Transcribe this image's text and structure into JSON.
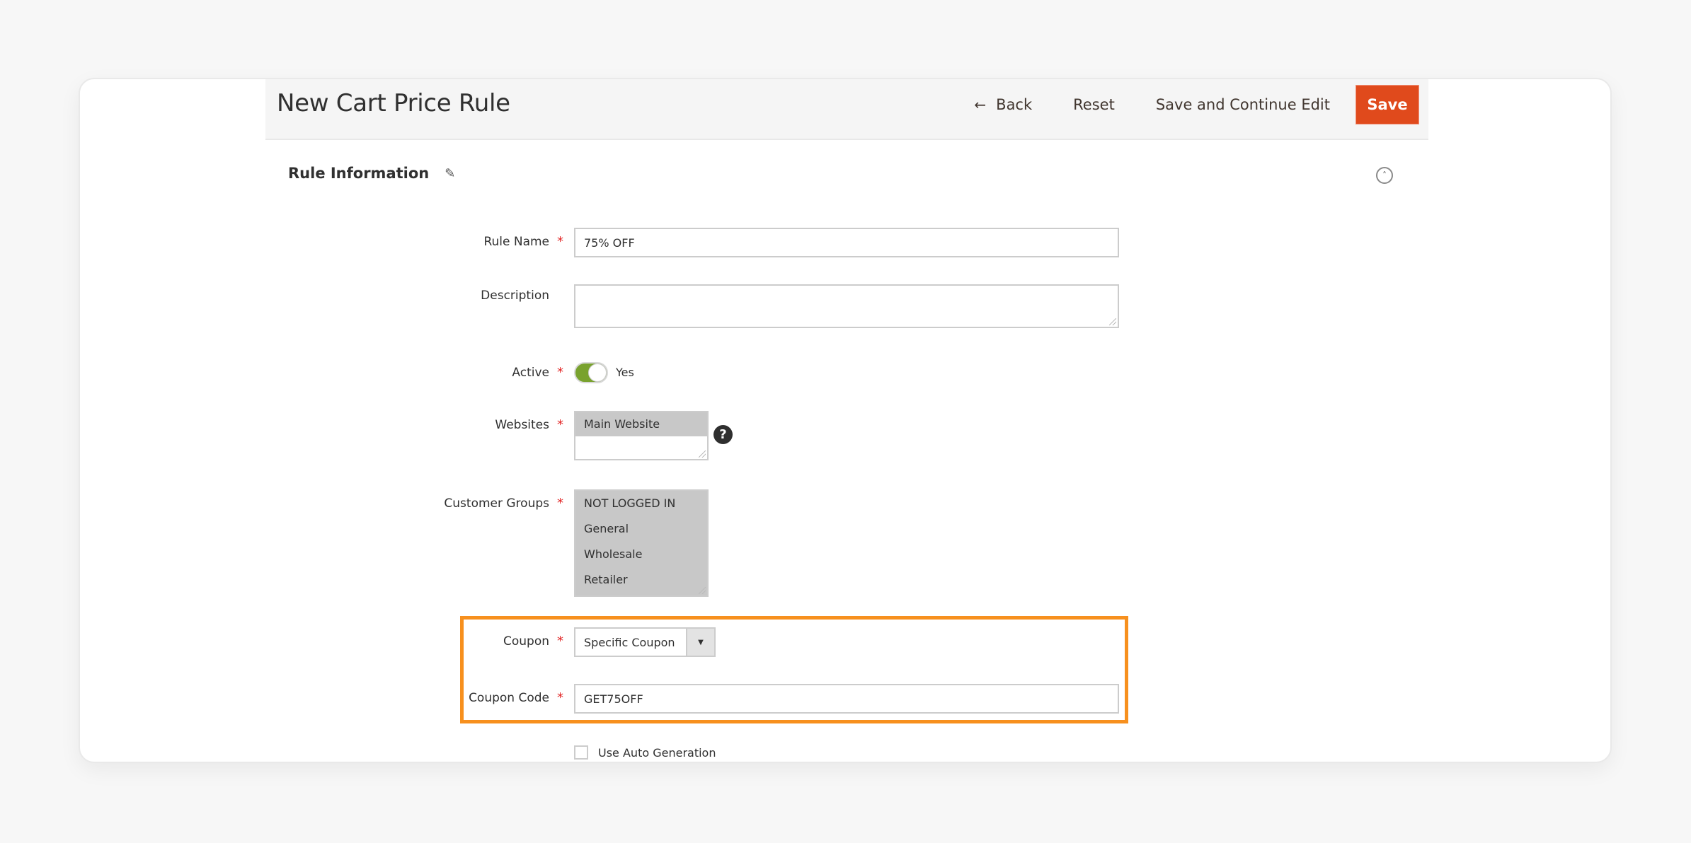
{
  "header": {
    "title": "New Cart Price Rule",
    "actions": {
      "back_label": "Back",
      "back_icon": "←",
      "reset_label": "Reset",
      "save_continue_label": "Save and Continue Edit",
      "save_label": "Save"
    }
  },
  "section": {
    "title": "Rule Information",
    "edit_icon": "✎",
    "collapse_icon": "˄"
  },
  "form": {
    "required_marker": "*",
    "rule_name": {
      "label": "Rule Name",
      "value": "75% OFF",
      "required": true
    },
    "description": {
      "label": "Description",
      "value": ""
    },
    "active": {
      "label": "Active",
      "state": "Yes",
      "on": true
    },
    "websites": {
      "label": "Websites",
      "options": [
        "Main Website"
      ],
      "help_icon": "?"
    },
    "customer_groups": {
      "label": "Customer Groups",
      "options": [
        "NOT LOGGED IN",
        "General",
        "Wholesale",
        "Retailer"
      ]
    },
    "coupon": {
      "label": "Coupon",
      "value": "Specific Coupon",
      "arrow": "▼"
    },
    "coupon_code": {
      "label": "Coupon Code",
      "value": "GET75OFF"
    },
    "auto_generation": {
      "label": "Use Auto Generation",
      "checked": false
    }
  },
  "colors": {
    "primary_button": "#e04a1c",
    "toggle_on": "#79a22e",
    "required": "#e22626",
    "highlight": "#f7901e"
  }
}
